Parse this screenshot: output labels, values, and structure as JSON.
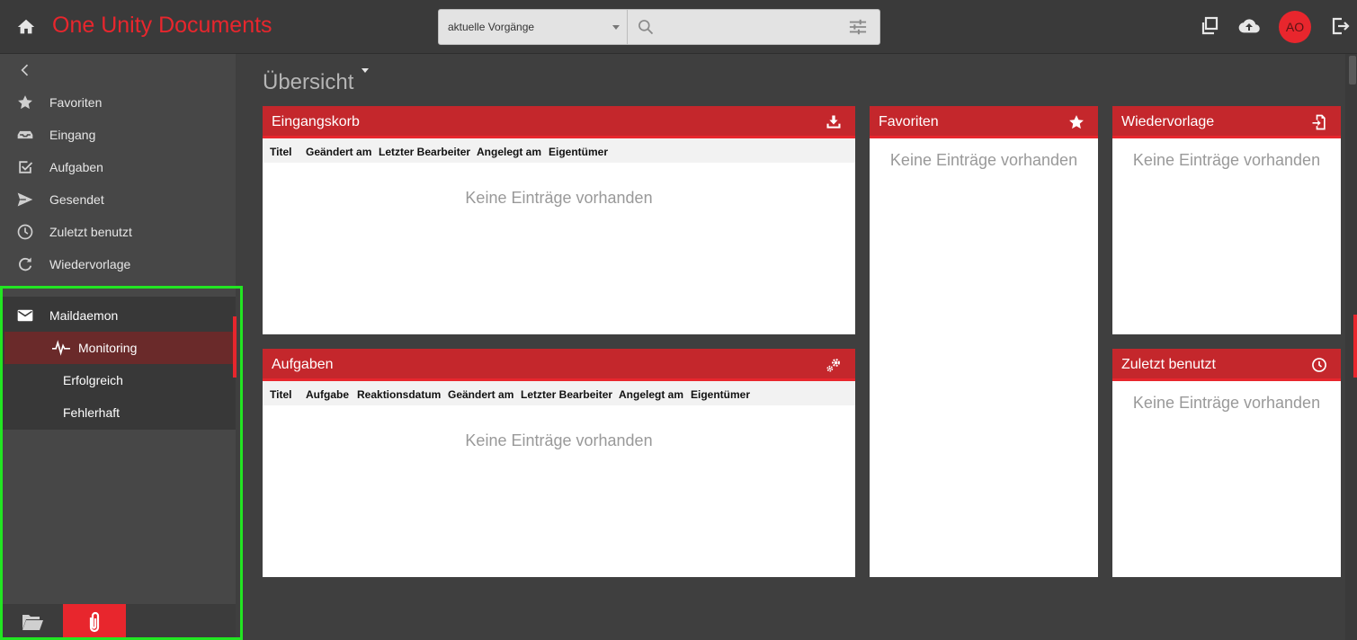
{
  "header": {
    "app_title": "One Unity Documents",
    "home_icon": "home-icon",
    "search": {
      "scope_value": "aktuelle Vorgänge",
      "placeholder": "",
      "search_icon": "search-icon",
      "filter_icon": "sliders-icon"
    },
    "actions": [
      "window-restore-icon",
      "cloud-upload-icon",
      "logout-icon"
    ],
    "avatar_initials": "AO"
  },
  "sidebar": {
    "back_icon": "chevron-left-icon",
    "items": [
      {
        "label": "Favoriten",
        "icon": "star-icon"
      },
      {
        "label": "Eingang",
        "icon": "inbox-icon"
      },
      {
        "label": "Aufgaben",
        "icon": "checkbox-icon"
      },
      {
        "label": "Gesendet",
        "icon": "send-icon"
      },
      {
        "label": "Zuletzt benutzt",
        "icon": "clock-icon"
      },
      {
        "label": "Wiedervorlage",
        "icon": "refresh-icon"
      }
    ],
    "group": {
      "label": "Maildaemon",
      "icon": "mail-icon",
      "active_sub": {
        "label": "Monitoring",
        "icon": "pulse-icon"
      },
      "subs": [
        "Erfolgreich",
        "Fehlerhaft"
      ]
    },
    "footer": [
      "folder-open-icon",
      "paperclip-icon"
    ]
  },
  "main": {
    "page_title": "Übersicht",
    "empty_text": "Keine Einträge vorhanden",
    "panels": {
      "eingangskorb": {
        "title": "Eingangskorb",
        "columns": [
          "Titel",
          "Geändert am",
          "Letzter Bearbeiter",
          "Angelegt am",
          "Eigentümer"
        ],
        "empty": "Keine Einträge vorhanden"
      },
      "aufgaben": {
        "title": "Aufgaben",
        "columns": [
          "Titel",
          "Aufgabe",
          "Reaktionsdatum",
          "Geändert am",
          "Letzter Bearbeiter",
          "Angelegt am",
          "Eigentümer"
        ],
        "empty": "Keine Einträge vorhanden"
      },
      "favoriten": {
        "title": "Favoriten",
        "empty": "Keine Einträge vorhanden"
      },
      "wiedervorlage": {
        "title": "Wiedervorlage",
        "empty": "Keine Einträge vorhanden"
      },
      "zuletzt": {
        "title": "Zuletzt benutzt",
        "empty": "Keine Einträge vorhanden"
      }
    }
  },
  "colors": {
    "brand_red": "#e8262d",
    "panel_header": "#c4272c",
    "background": "#3f3f3f",
    "sidebar": "#474747",
    "highlight_frame": "#22e622"
  }
}
